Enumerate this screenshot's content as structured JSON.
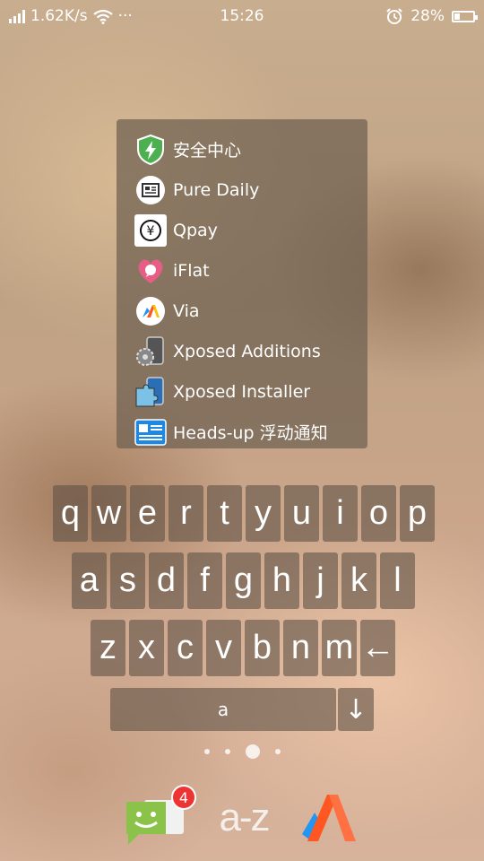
{
  "status_bar": {
    "net_speed": "1.62K/s",
    "more": "···",
    "time": "15:26",
    "battery_percent": "28%",
    "battery_level": 0.28,
    "icons": [
      "signal-icon",
      "wifi-icon",
      "alarm-icon",
      "battery-icon"
    ]
  },
  "app_list": [
    {
      "label": "安全中心",
      "icon": "shield-icon"
    },
    {
      "label": "Pure Daily",
      "icon": "newspaper-icon"
    },
    {
      "label": "Qpay",
      "icon": "yen-icon"
    },
    {
      "label": "iFlat",
      "icon": "heart-chat-icon"
    },
    {
      "label": "Via",
      "icon": "via-icon"
    },
    {
      "label": "Xposed Additions",
      "icon": "gear-phone-icon"
    },
    {
      "label": "Xposed Installer",
      "icon": "puzzle-icon"
    },
    {
      "label": "Heads-up 浮动通知",
      "icon": "id-card-icon"
    }
  ],
  "keyboard": {
    "row1": [
      "q",
      "w",
      "e",
      "r",
      "t",
      "y",
      "u",
      "i",
      "o",
      "p"
    ],
    "row2": [
      "a",
      "s",
      "d",
      "f",
      "g",
      "h",
      "j",
      "k",
      "l"
    ],
    "row3": [
      "z",
      "x",
      "c",
      "v",
      "b",
      "n",
      "m",
      "←"
    ],
    "space_label": "a",
    "enter_label": "↓"
  },
  "dock": {
    "messages_badge": "4",
    "az_label": "a-z",
    "icons": [
      "messages-icon",
      "az-icon",
      "via-icon"
    ]
  },
  "colors": {
    "via_orange": "#ff5722",
    "via_blue": "#2196f3",
    "messages_green": "#8bc34a",
    "badge_red": "#e33333"
  }
}
